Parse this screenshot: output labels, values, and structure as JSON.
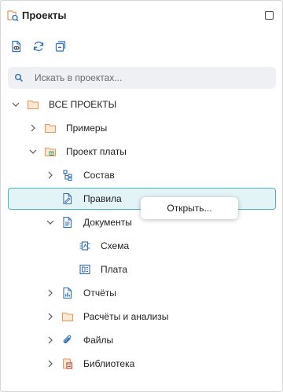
{
  "header": {
    "title": "Проекты"
  },
  "toolbar": {
    "buttons": [
      "open-document-icon",
      "refresh-icon",
      "collapse-all-icon"
    ]
  },
  "search": {
    "placeholder": "Искать в проектах..."
  },
  "tree": {
    "items": [
      {
        "label": "ВСЕ ПРОЕКТЫ",
        "icon": "folder-icon",
        "expanded": true
      },
      {
        "label": "Примеры",
        "icon": "folder-icon",
        "expanded": false
      },
      {
        "label": "Проект платы",
        "icon": "board-project-icon",
        "expanded": true
      },
      {
        "label": "Состав",
        "icon": "hierarchy-icon",
        "expanded": false
      },
      {
        "label": "Правила",
        "icon": "rules-icon",
        "selected": true
      },
      {
        "label": "Документы",
        "icon": "documents-icon",
        "expanded": true
      },
      {
        "label": "Схема",
        "icon": "schematic-icon"
      },
      {
        "label": "Плата",
        "icon": "pcb-icon"
      },
      {
        "label": "Отчёты",
        "icon": "report-icon",
        "expanded": false
      },
      {
        "label": "Расчёты и анализы",
        "icon": "folder-icon",
        "expanded": false
      },
      {
        "label": "Файлы",
        "icon": "paperclip-icon",
        "expanded": false
      },
      {
        "label": "Библиотека",
        "icon": "library-icon",
        "expanded": false
      }
    ]
  },
  "context_menu": {
    "items": [
      "Открыть..."
    ]
  },
  "colors": {
    "accent": "#4bb3bb",
    "selection_bg": "#e3f4f6",
    "icon_blue": "#2f6fb8",
    "folder_orange": "#e8965a"
  }
}
